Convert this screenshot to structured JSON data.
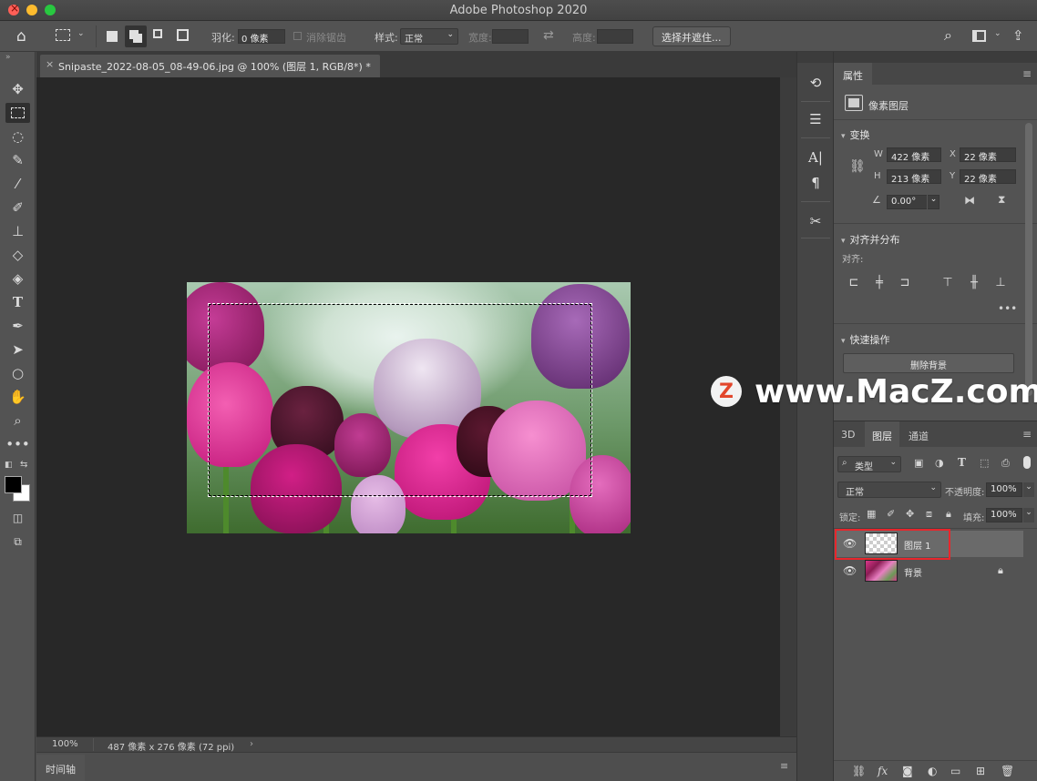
{
  "window": {
    "title": "Adobe Photoshop 2020"
  },
  "options": {
    "feather_label": "羽化:",
    "feather_value": "0 像素",
    "antialias_label": "消除锯齿",
    "style_label": "样式:",
    "style_value": "正常",
    "width_label": "宽度:",
    "height_label": "高度:",
    "select_mask_button": "选择并遮住..."
  },
  "document": {
    "tab_title": "Snipaste_2022-08-05_08-49-06.jpg @ 100% (图层 1, RGB/8*) *",
    "zoom": "100%",
    "info": "487 像素 x 276 像素 (72 ppi)"
  },
  "timeline": {
    "label": "时间轴"
  },
  "properties": {
    "tab": "属性",
    "layer_kind": "像素图层",
    "transform": {
      "header": "变换",
      "w_label": "W",
      "w_value": "422 像素",
      "h_label": "H",
      "h_value": "213 像素",
      "x_label": "X",
      "x_value": "22 像素",
      "y_label": "Y",
      "y_value": "22 像素",
      "angle_value": "0.00°"
    },
    "align": {
      "header": "对齐并分布",
      "label": "对齐:"
    },
    "quick": {
      "header": "快速操作",
      "remove_bg": "删除背景"
    }
  },
  "layers": {
    "tabs": [
      "3D",
      "图层",
      "通道"
    ],
    "filter_type": "类型",
    "blend_mode": "正常",
    "opacity_label": "不透明度:",
    "opacity_value": "100%",
    "lock_label": "锁定:",
    "fill_label": "填充:",
    "fill_value": "100%",
    "items": [
      {
        "name": "图层 1",
        "selected": true
      },
      {
        "name": "背景",
        "locked": true
      }
    ],
    "fx_label": "fx"
  },
  "watermark": {
    "logo": "Z",
    "text": "www.MacZ.com"
  },
  "colors": {
    "highlight": "#e8262c",
    "panel": "#535353",
    "canvas": "#282828"
  }
}
